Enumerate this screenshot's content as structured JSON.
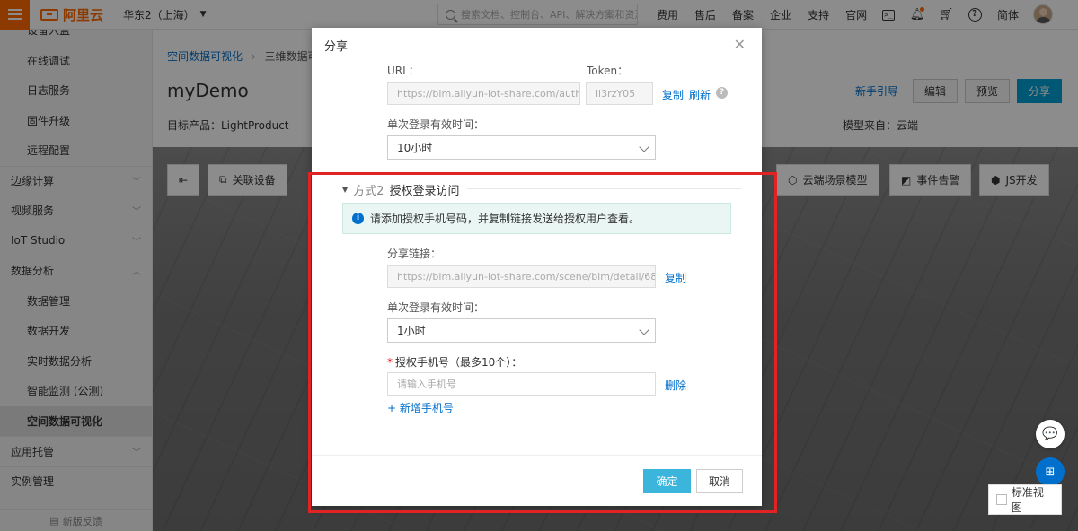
{
  "topbar": {
    "logo_text": "阿里云",
    "region": "华东2（上海）",
    "search_placeholder": "搜索文档、控制台、API、解决方案和资源",
    "nav": [
      "费用",
      "售后",
      "备案",
      "企业",
      "支持",
      "官网"
    ],
    "language": "简体",
    "accent_color": "#ff6a00"
  },
  "sidebar": {
    "items": [
      {
        "label": "设备入盒",
        "type": "sub"
      },
      {
        "label": "在线调试",
        "type": "sub"
      },
      {
        "label": "日志服务",
        "type": "sub"
      },
      {
        "label": "固件升级",
        "type": "sub"
      },
      {
        "label": "远程配置",
        "type": "sub"
      },
      {
        "label": "边缘计算",
        "type": "group",
        "chevron": "﹀"
      },
      {
        "label": "视频服务",
        "type": "group",
        "chevron": "﹀"
      },
      {
        "label": "IoT Studio",
        "type": "group",
        "chevron": "﹀"
      },
      {
        "label": "数据分析",
        "type": "group",
        "chevron": "︿"
      },
      {
        "label": "数据管理",
        "type": "sub"
      },
      {
        "label": "数据开发",
        "type": "sub"
      },
      {
        "label": "实时数据分析",
        "type": "sub"
      },
      {
        "label": "智能监测 (公测)",
        "type": "sub"
      },
      {
        "label": "空间数据可视化",
        "type": "sub",
        "active": true
      },
      {
        "label": "应用托管",
        "type": "group",
        "chevron": "﹀"
      },
      {
        "label": "实例管理",
        "type": "group"
      }
    ],
    "feedback": "新版反馈"
  },
  "header": {
    "breadcrumb": [
      "空间数据可视化",
      "三维数据可"
    ],
    "title": "myDemo",
    "product": "目标产品：LightProduct",
    "model_from": "模型来自：云端",
    "guide": "新手引导",
    "edit": "编辑",
    "preview": "预览",
    "share": "分享"
  },
  "toolbar": {
    "left": [
      {
        "label": "",
        "icon": "⇤"
      },
      {
        "label": "关联设备",
        "icon": "⧉"
      }
    ],
    "right": [
      {
        "label": "云端场景模型",
        "icon": "⬡"
      },
      {
        "label": "事件告警",
        "icon": "◩"
      },
      {
        "label": "JS开发",
        "icon": "⬢"
      }
    ]
  },
  "floor": {
    "chat_icon": "💬",
    "grid_icon": "⊞",
    "standard_view": "标准视图"
  },
  "modal": {
    "title": "分享",
    "url_label": "URL：",
    "url_value": "https://bim.aliyun-iot-share.com/auth/",
    "token_label": "Token：",
    "token_value": "il3rzY05",
    "copy": "复制",
    "refresh": "刷新",
    "login_valid_label_1": "单次登录有效时间：",
    "login_valid_value_1": "10小时",
    "section_prefix": "方式2",
    "section_title": "授权登录访问",
    "notice": "请添加授权手机号码，并复制链接发送给授权用户查看。",
    "share_link_label": "分享链接：",
    "share_link_value": "https://bim.aliyun-iot-share.com/scene/bim/detail/68",
    "share_copy": "复制",
    "login_valid_label_2": "单次登录有效时间：",
    "login_valid_value_2": "1小时",
    "phone_label": "授权手机号（最多10个）：",
    "phone_placeholder": "请输入手机号",
    "delete": "删除",
    "add_phone": "+ 新增手机号",
    "ok": "确定",
    "cancel": "取消"
  }
}
